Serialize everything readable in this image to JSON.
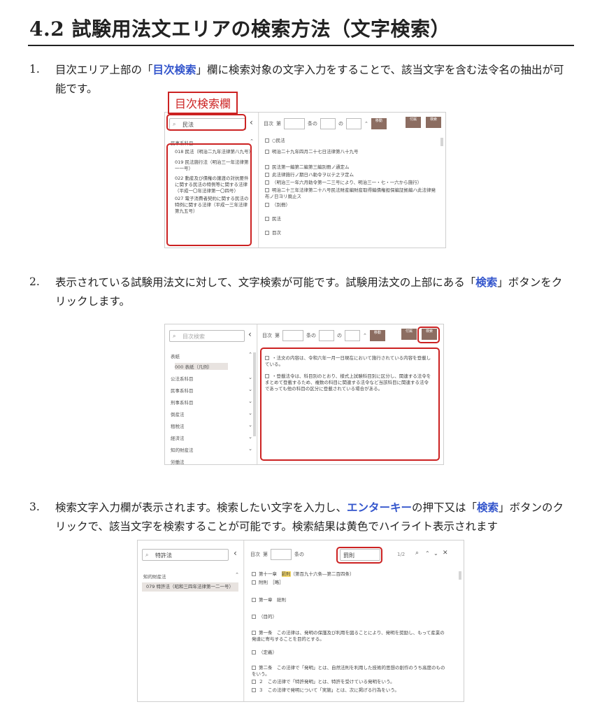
{
  "title": "4.2 試験用法文エリアの検索方法（文字検索）",
  "steps": [
    {
      "num": "1.",
      "pre": "目次エリア上部の「",
      "hl": "目次検索",
      "post": "」欄に検索対象の文字入力をすることで、該当文字を含む法令名の抽出が可能です。"
    },
    {
      "num": "2.",
      "pre": "表示されている試験用法文に対して、文字検索が可能です。試験用法文の上部にある「",
      "hl": "検索",
      "post": "」ボタンをクリックします。"
    },
    {
      "num": "3.",
      "pre": "検索文字入力欄が表示されます。検索したい文字を入力し、",
      "hl": "エンターキー",
      "mid": "の押下又は「",
      "hl2": "検索",
      "post": "」ボタンのクリックで、該当文字を検索することが可能です。検索結果は黄色でハイライト表示されます"
    }
  ],
  "shot1": {
    "callout_label": "目次検索欄",
    "search_value": "民法",
    "toolbar": {
      "mokuji": "目次",
      "dai": "第",
      "jo": "条の",
      "no": "の",
      "jump": "移動",
      "fuzoku": "付属",
      "kensaku": "検索"
    },
    "section": "民事系科目",
    "items": [
      "018 民法（明治二九年法律第八九号）",
      "019 民法施行法（明治三一年法律第一一号）",
      "022 動産及び債権の譲渡の対抗要件に関する民法の特例等に関する法律（平成一〇年法律第一〇四号）",
      "027 電子消費者契約に関する民法の特例に関する法律（平成一三年法律第九五号）"
    ],
    "lines": [
      "○民法",
      "明治二十九年四月二十七日法律第八十九号",
      "民法第一編第二編第三編別冊ノ通定ム",
      "此法律施行ノ期日ハ勅令ヲ以テ之ヲ定ム",
      "（明治三一年六月勅令第一二三号により、明治三一・七・一六から施行）",
      "明治二十三年法律第二十八号民法財産編財産取得編債権担保編証拠編ハ此法律発布ノ日ヨリ廃止ス",
      "（別冊）",
      "民法",
      "目次"
    ]
  },
  "shot2": {
    "search_placeholder": "目次検索",
    "nav": [
      "表紙",
      "000 表紙（凡例）",
      "公法系科目",
      "民事系科目",
      "刑事系科目",
      "倒産法",
      "租税法",
      "経済法",
      "知的財産法",
      "労働法"
    ],
    "lines": [
      "・法文の内容は、令和六年一月一日現在において施行されている内容を登載している。",
      "・登載法令は、科目別のとおり、様式上試験科目別に区分し、関連する法令をまとめて登載するため、複数の科目に関連する法令など当該科目に関連する法令であっても他の科目の区分に登載されている場合がある。"
    ]
  },
  "shot3": {
    "search_value": "特許法",
    "find_value": "罰則",
    "find_count": "1/2",
    "section": "知的財産法",
    "item": "079 特許法（昭和三四年法律第一二一号）",
    "lines_a": [
      "第十一章",
      "罰則",
      "（第百九十六条―第二百四条）"
    ],
    "lines": [
      "附則　［略］",
      "第一章　総則",
      "（目的）",
      "第一条　この法律は、発明の保護及び利用を図ることにより、発明を奨励し、もって産業の発達に寄与することを目的とする。",
      "（定義）",
      "第二条　この法律で「発明」とは、自然法則を利用した技術的思想の創作のうち高度のものをいう。",
      "２　この法律で「特許発明」とは、特許を受けている発明をいう。",
      "３　この法律で発明について「実施」とは、次に掲げる行為をいう。"
    ]
  }
}
